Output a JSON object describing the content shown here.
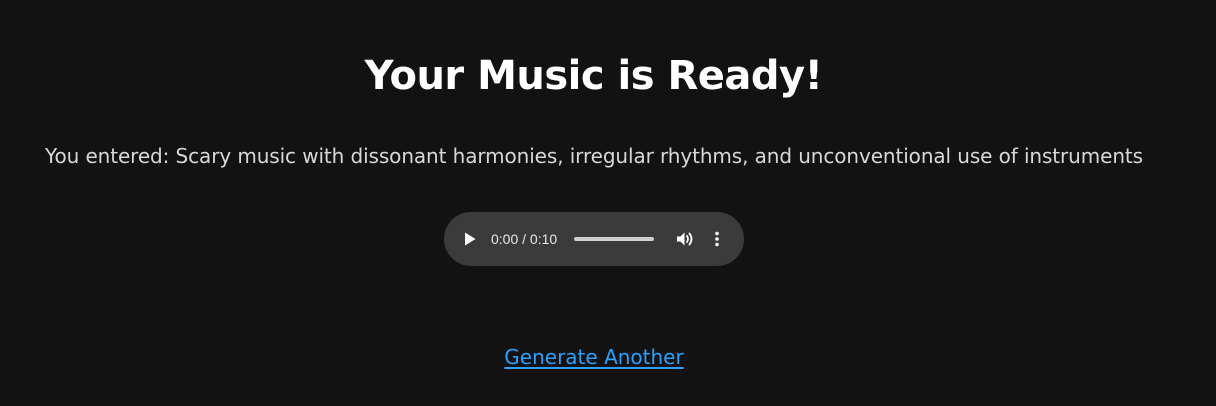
{
  "page": {
    "title": "Your Music is Ready!",
    "prompt_text": "You entered: Scary music with dissonant harmonies, irregular rhythms, and unconventional use of instruments",
    "generate_link_label": "Generate Another"
  },
  "player": {
    "time_display": "0:00 / 0:10",
    "progress_fraction": 0,
    "play_icon": "play-icon",
    "volume_icon": "volume-icon",
    "more_icon": "more-vertical-icon"
  },
  "colors": {
    "background": "#121212",
    "player_bg": "#3b3b3b",
    "link": "#2aa0ff"
  }
}
